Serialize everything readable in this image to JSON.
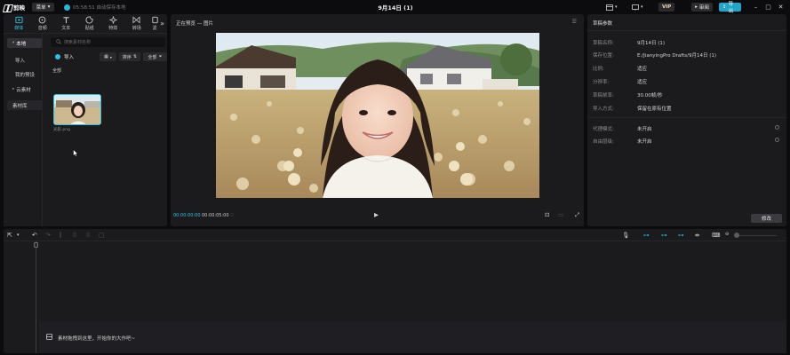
{
  "app": {
    "logo_text": "剪映",
    "menu_label": "菜单",
    "autosave_text": "05:58:51 自动保存本地",
    "document_title": "9月14日 (1)",
    "vip_label": "VIP",
    "shortcut_label": "审阅",
    "export_label": "导出"
  },
  "tool_tabs": [
    {
      "label": "媒体",
      "icon": "media-icon"
    },
    {
      "label": "音频",
      "icon": "audio-icon"
    },
    {
      "label": "文本",
      "icon": "text-icon"
    },
    {
      "label": "贴纸",
      "icon": "sticker-icon"
    },
    {
      "label": "特效",
      "icon": "effects-icon"
    },
    {
      "label": "转场",
      "icon": "transition-icon"
    },
    {
      "label": "滤",
      "icon": "filter-icon"
    }
  ],
  "sidebar": {
    "items": [
      {
        "label": "本地"
      },
      {
        "label": "导入"
      },
      {
        "label": "我的预设"
      },
      {
        "label": "云素材"
      },
      {
        "label": "素材库"
      }
    ]
  },
  "media": {
    "search_placeholder": "搜索素材名称",
    "import_label": "导入",
    "sort_label": "排序",
    "all_filter_label": "全部",
    "section_label": "全部",
    "thumb_name": "光影.png"
  },
  "preview": {
    "title": "正在预览 — 图片",
    "time_current": "00:00:00:00",
    "time_total": "00:00:05:00"
  },
  "properties": {
    "title": "草稿参数",
    "rows": [
      {
        "label": "草稿名称:",
        "value": "9月14日 (1)"
      },
      {
        "label": "保存位置:",
        "value": "E:/JianyingPro Drafts/9月14日 (1)"
      },
      {
        "label": "比例:",
        "value": "适应"
      },
      {
        "label": "分辨率:",
        "value": "适应"
      },
      {
        "label": "草稿帧率:",
        "value": "30.00帧/秒"
      },
      {
        "label": "导入方式:",
        "value": "保留在原有位置"
      },
      {
        "label": "代理模式:",
        "value": "未开启"
      },
      {
        "label": "自由层级:",
        "value": "未开启"
      }
    ],
    "modify_label": "修改"
  },
  "timeline": {
    "drop_hint": "素材拖拽到这里，开始你的大作吧~"
  },
  "colors": {
    "accent": "#2cc3e3",
    "panel": "#1b1b1e",
    "background": "#0c0c0e"
  }
}
